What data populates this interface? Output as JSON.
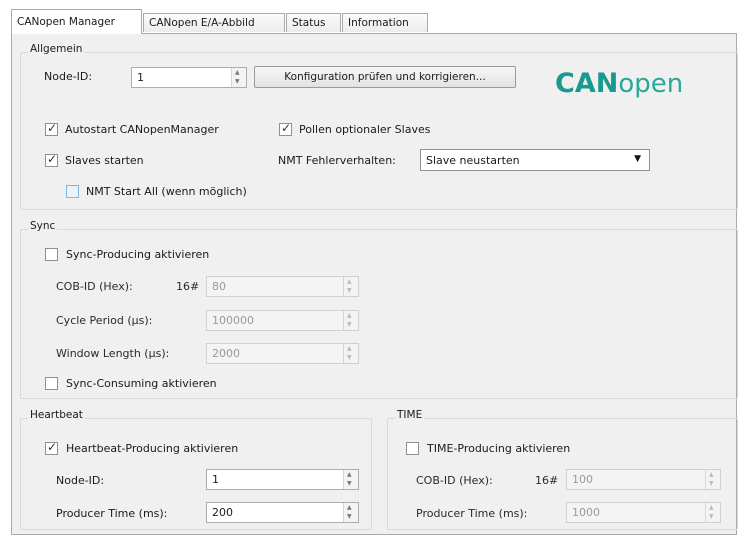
{
  "tabs": [
    {
      "label": "CANopen Manager"
    },
    {
      "label": "CANopen E/A-Abbild"
    },
    {
      "label": "Status"
    },
    {
      "label": "Information"
    }
  ],
  "logo": {
    "part1": "CAN",
    "part2": "open",
    "color1": "#1a9a8e",
    "color2": "#2aa89a"
  },
  "allgemein": {
    "title": "Allgemein",
    "node_id_label": "Node-ID:",
    "node_id_value": "1",
    "check_button": "Konfiguration prüfen und korrigieren...",
    "autostart_label": "Autostart CANopenManager",
    "autostart_checked": true,
    "poll_label": "Pollen optionaler Slaves",
    "poll_checked": true,
    "slaves_label": "Slaves starten",
    "slaves_checked": true,
    "nmt_error_label": "NMT Fehlerverhalten:",
    "nmt_error_value": "Slave neustarten",
    "nmt_start_all_label": "NMT Start All (wenn möglich)",
    "nmt_start_all_checked": false
  },
  "sync": {
    "title": "Sync",
    "producing_label": "Sync-Producing aktivieren",
    "producing_checked": false,
    "cobid_label": "COB-ID (Hex):",
    "cobid_prefix": "16#",
    "cobid_value": "80",
    "cycle_label": "Cycle Period (µs):",
    "cycle_value": "100000",
    "window_label": "Window Length (µs):",
    "window_value": "2000",
    "consuming_label": "Sync-Consuming aktivieren",
    "consuming_checked": false
  },
  "heartbeat": {
    "title": "Heartbeat",
    "producing_label": "Heartbeat-Producing aktivieren",
    "producing_checked": true,
    "node_id_label": "Node-ID:",
    "node_id_value": "1",
    "producer_time_label": "Producer Time (ms):",
    "producer_time_value": "200"
  },
  "time": {
    "title": "TIME",
    "producing_label": "TIME-Producing aktivieren",
    "producing_checked": false,
    "cobid_label": "COB-ID (Hex):",
    "cobid_prefix": "16#",
    "cobid_value": "100",
    "producer_time_label": "Producer Time (ms):",
    "producer_time_value": "1000"
  }
}
